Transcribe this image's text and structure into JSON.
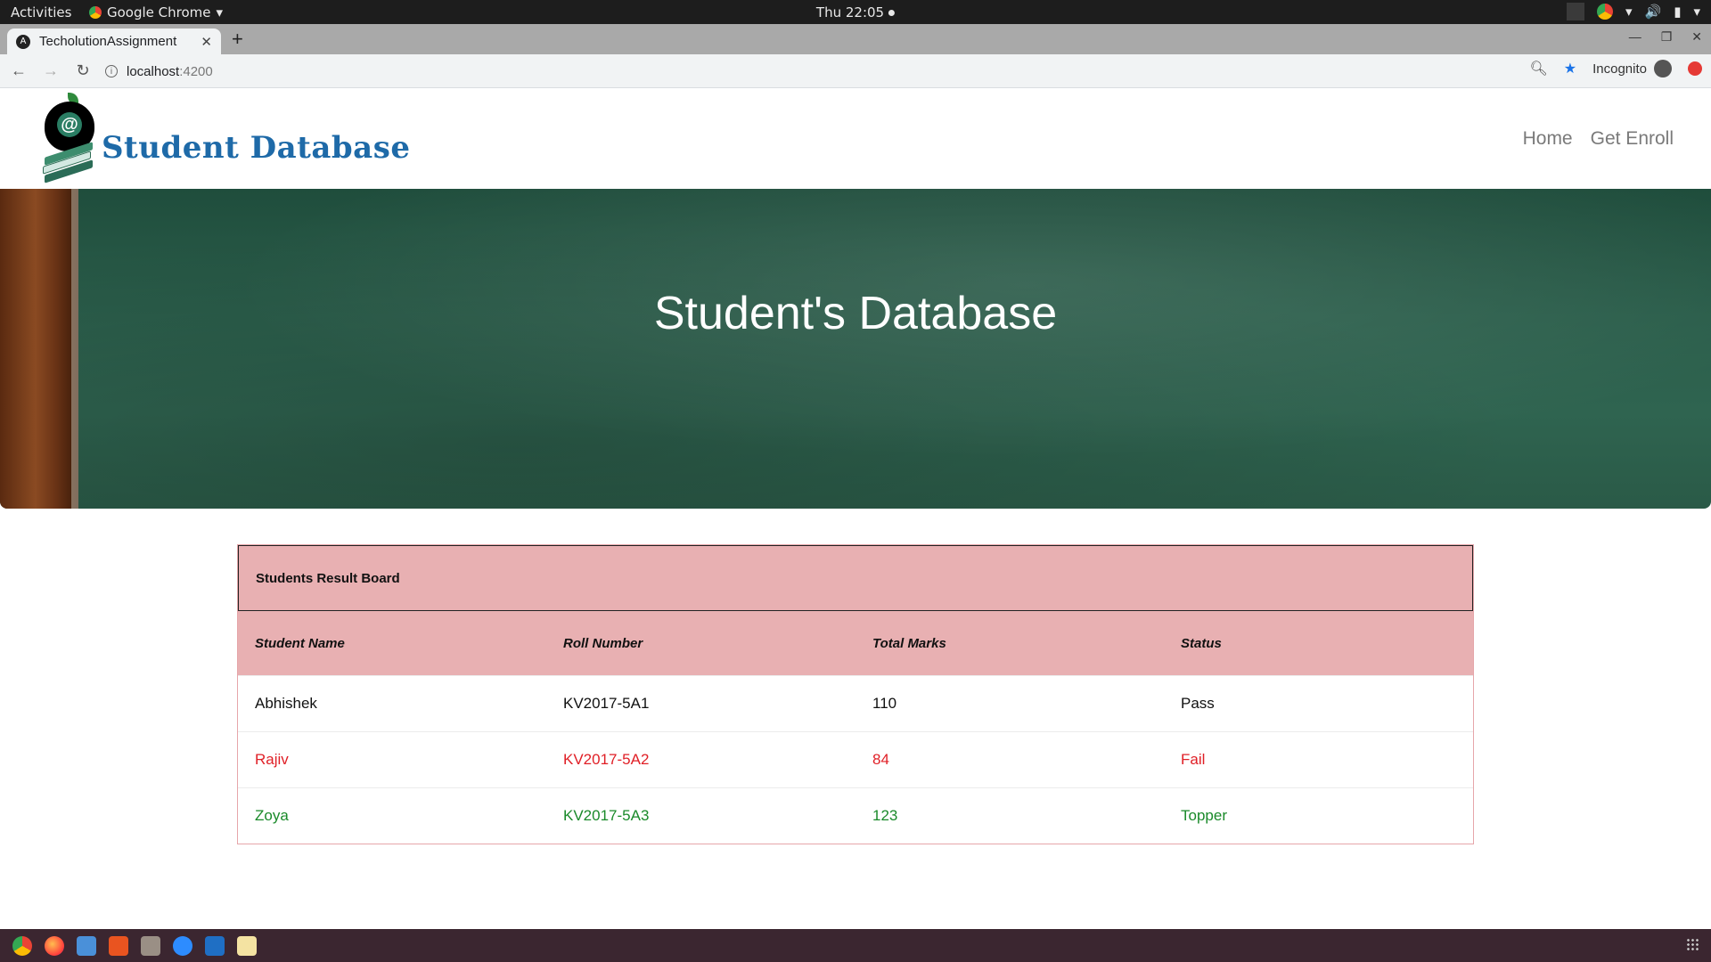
{
  "system": {
    "activities": "Activities",
    "app_name": "Google Chrome",
    "clock": "Thu 22:05"
  },
  "browser": {
    "tab_title": "TecholutionAssignment",
    "url_host": "localhost",
    "url_port": ":4200",
    "incognito_label": "Incognito"
  },
  "site": {
    "logo_text": "Student Database",
    "nav": {
      "home": "Home",
      "enroll": "Get Enroll"
    },
    "hero_title": "Student's Database"
  },
  "board": {
    "title": "Students Result Board",
    "columns": [
      "Student Name",
      "Roll Number",
      "Total Marks",
      "Status"
    ],
    "rows": [
      {
        "name": "Abhishek",
        "roll": "KV2017-5A1",
        "marks": "110",
        "status": "Pass"
      },
      {
        "name": "Rajiv",
        "roll": "KV2017-5A2",
        "marks": "84",
        "status": "Fail"
      },
      {
        "name": "Zoya",
        "roll": "KV2017-5A3",
        "marks": "123",
        "status": "Topper"
      }
    ]
  },
  "colors": {
    "header_pink": "#e8b0b2",
    "fail_red": "#e01f26",
    "topper_green": "#1a8a2a",
    "chalkboard_green": "#2b5e4b",
    "logo_blue": "#1e6aa8"
  },
  "taskbar_icons": [
    "chrome-icon",
    "firefox-icon",
    "text-editor-icon",
    "software-center-icon",
    "files-icon",
    "zoom-icon",
    "vscode-icon",
    "notes-icon"
  ]
}
